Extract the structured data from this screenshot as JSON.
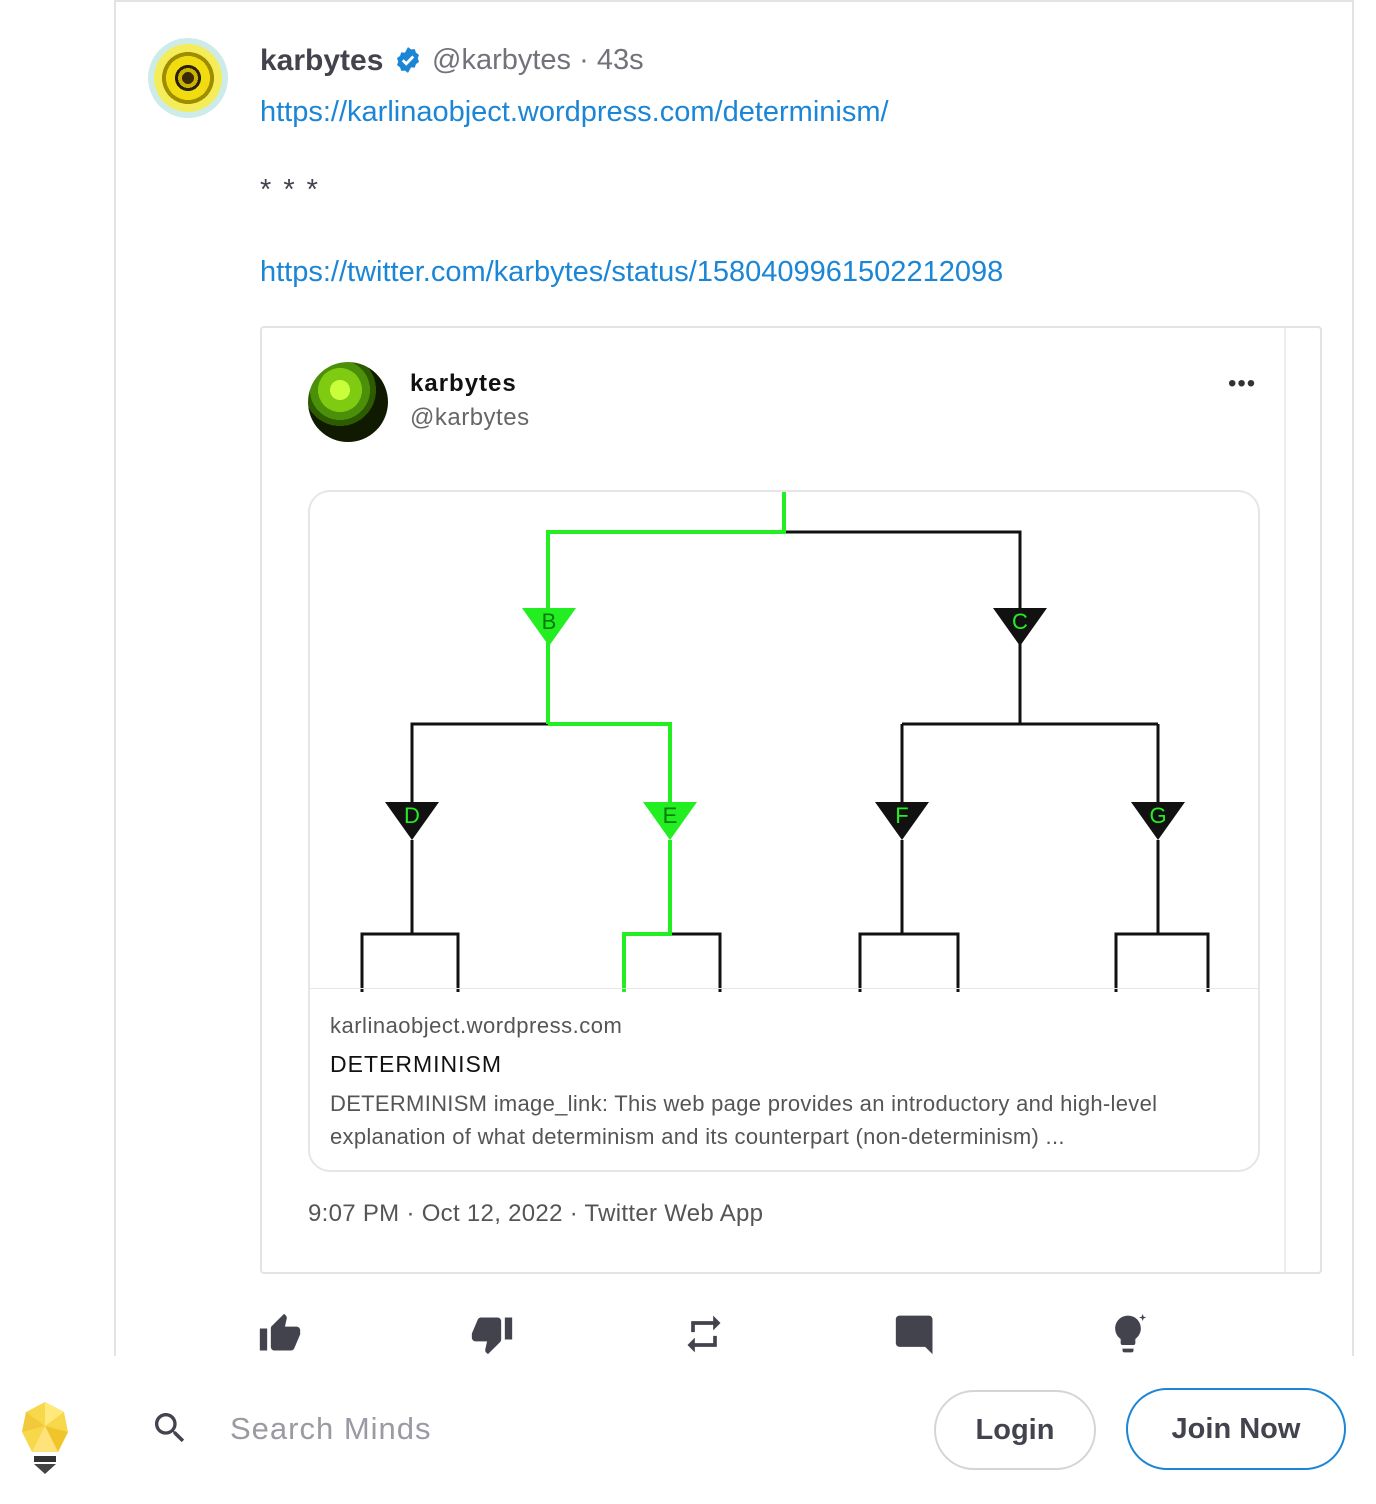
{
  "post": {
    "author_name": "karbytes",
    "author_handle": "@karbytes",
    "separator": "·",
    "time_ago": "43s",
    "link1": "https://karlinaobject.wordpress.com/determinism/",
    "stars": "* * *",
    "link2": "https://twitter.com/karbytes/status/1580409961502212098"
  },
  "embed": {
    "name": "karbytes",
    "handle": "@karbytes",
    "more": "•••",
    "card": {
      "domain": "karlinaobject.wordpress.com",
      "title": "DETERMINISM",
      "description": "DETERMINISM image_link: This web page provides an introductory and high-level explanation of what determinism and its counterpart (non-determinism) ...",
      "tree_labels": [
        "B",
        "C",
        "D",
        "E",
        "F",
        "G"
      ]
    },
    "timestamp": "9:07 PM · Oct 12, 2022 · Twitter Web App"
  },
  "actions": [
    {
      "icon": "thumb-up-icon"
    },
    {
      "icon": "thumb-down-icon"
    },
    {
      "icon": "remind-icon"
    },
    {
      "icon": "comment-icon"
    },
    {
      "icon": "boost-icon"
    }
  ],
  "bottombar": {
    "logo_icon": "minds-logo-icon",
    "search_placeholder": "Search Minds",
    "login_label": "Login",
    "join_label": "Join Now"
  },
  "colors": {
    "link": "#1b85d6",
    "path_highlight": "#22ee22",
    "text": "#43434d"
  }
}
